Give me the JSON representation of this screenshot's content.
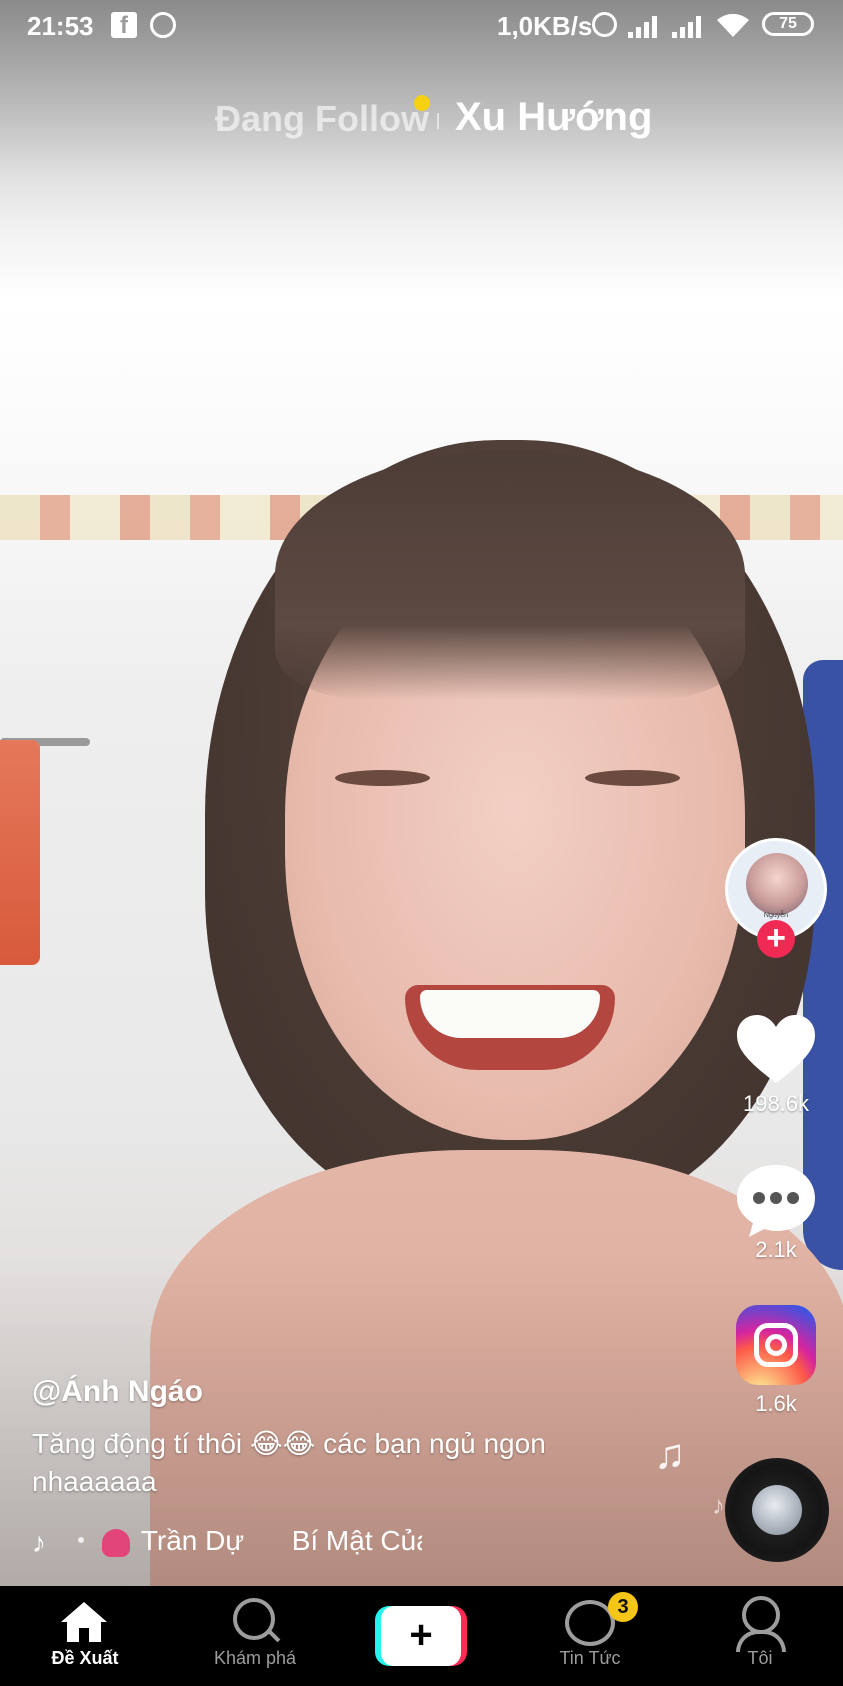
{
  "status_bar": {
    "time": "21:53",
    "network_speed": "1,0KB/s",
    "battery": "75",
    "icons": [
      "facebook-icon",
      "messenger-icon",
      "alarm-icon",
      "signal-icon",
      "signal-icon",
      "wifi-icon",
      "battery-icon"
    ]
  },
  "top_tabs": {
    "following": "Đang Follow",
    "trending": "Xu Hướng",
    "active": "trending"
  },
  "video": {
    "username": "@Ánh Ngáo",
    "caption": "Tăng động tí thôi 😂😂 các bạn ngủ ngon nhaaaaaa",
    "music_artist": "Trần Dự",
    "music_title": "Bí Mật Của",
    "avatar_caption": "Nguyễn"
  },
  "actions": {
    "likes": "198.6k",
    "comments": "2.1k",
    "shares": "1.6k"
  },
  "bottom_nav": {
    "home": "Đề Xuất",
    "discover": "Khám phá",
    "inbox": "Tin Tức",
    "inbox_badge": "3",
    "me": "Tôi",
    "create": "+"
  },
  "colors": {
    "accent_red": "#fe2c55",
    "accent_cyan": "#25f4ee",
    "live_dot": "#f5d10f",
    "badge_yellow": "#f5c518"
  }
}
